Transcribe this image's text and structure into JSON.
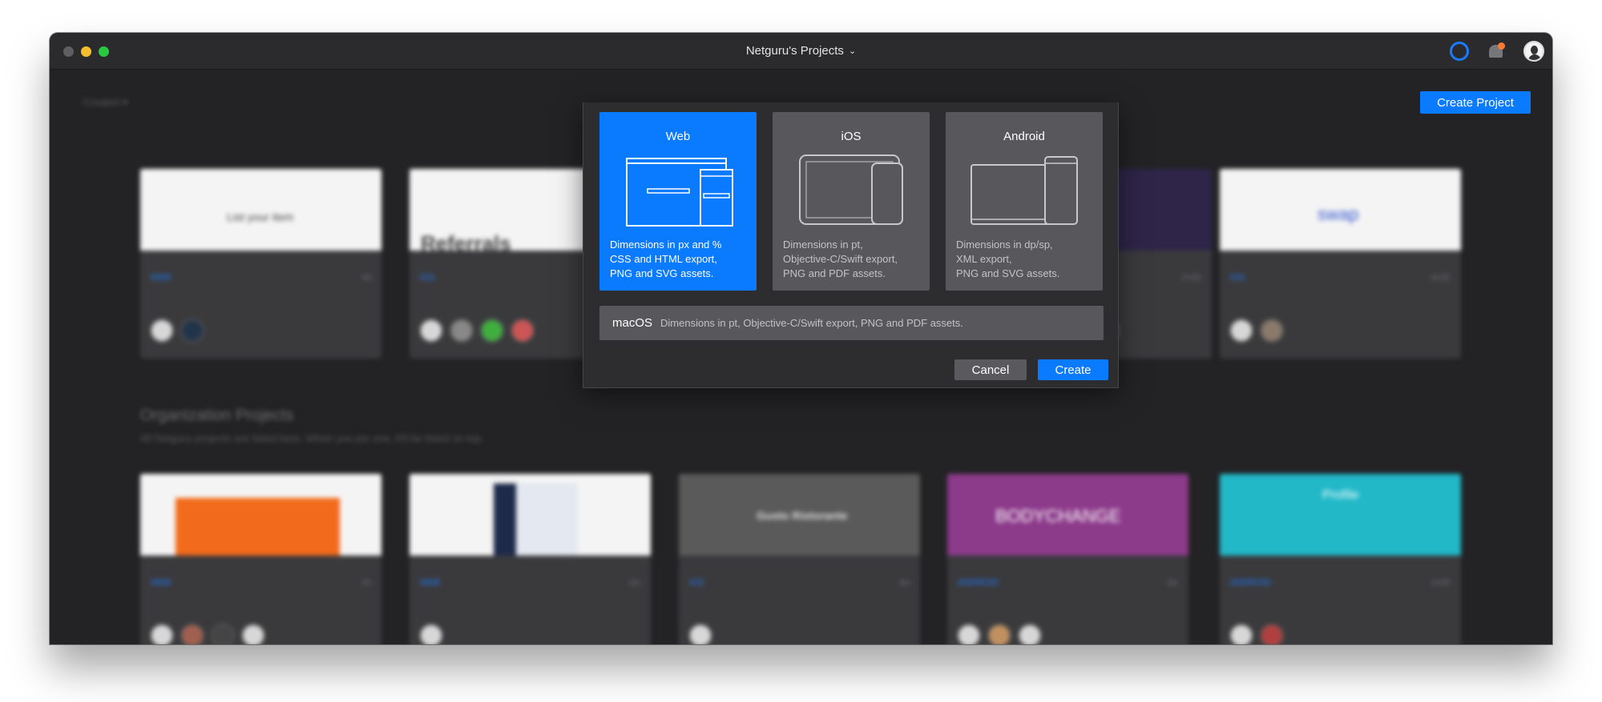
{
  "window": {
    "title": "Netguru's Projects"
  },
  "toolbar": {
    "filter_label": "Created",
    "create_project_label": "Create Project"
  },
  "section": {
    "title": "Organization Projects",
    "subtitle": "All Netguru projects are listed here. When you pin one, it'll be listed on top."
  },
  "cards_top": [
    {
      "thumb_text": "List your item",
      "platform": "WEB",
      "age": "4d",
      "avatars": 2
    },
    {
      "thumb_text": "Referrals",
      "platform": "iOS",
      "age": "",
      "avatars": 4
    },
    {
      "thumb_text": "",
      "platform": "",
      "age": "",
      "avatars": 0
    },
    {
      "thumb_text": "",
      "platform": "",
      "age": "2mth",
      "avatars": 2
    },
    {
      "thumb_text": "swap",
      "platform": "iOS",
      "age": "4mth",
      "avatars": 2
    }
  ],
  "cards_bottom": [
    {
      "thumb_text": "",
      "platform": "WEB",
      "age": "2h",
      "avatars": 4
    },
    {
      "thumb_text": "",
      "platform": "WEB",
      "age": "2w",
      "avatars": 1
    },
    {
      "thumb_text": "Gusto Ristorante",
      "platform": "iOS",
      "age": "3w",
      "avatars": 1
    },
    {
      "thumb_text": "BODYCHANGE",
      "platform": "ANDROID",
      "age": "3w",
      "avatars": 3
    },
    {
      "thumb_text": "Profile",
      "platform": "ANDROID",
      "age": "1mth",
      "avatars": 2
    }
  ],
  "dialog": {
    "options": [
      {
        "title": "Web",
        "description": "Dimensions in px and %\nCSS and HTML export,\nPNG and SVG assets.",
        "selected": true
      },
      {
        "title": "iOS",
        "description": "Dimensions in pt,\nObjective-C/Swift export,\nPNG and PDF assets.",
        "selected": false
      },
      {
        "title": "Android",
        "description": "Dimensions in dp/sp,\nXML export,\nPNG and SVG assets.",
        "selected": false
      }
    ],
    "macos": {
      "title": "macOS",
      "description": "Dimensions in pt, Objective-C/Swift export, PNG and PDF assets."
    },
    "cancel_label": "Cancel",
    "create_label": "Create"
  },
  "colors": {
    "accent": "#0a7aff",
    "window_bg": "#232325",
    "card_bg": "#3a3a3d",
    "option_bg": "#58585c"
  }
}
